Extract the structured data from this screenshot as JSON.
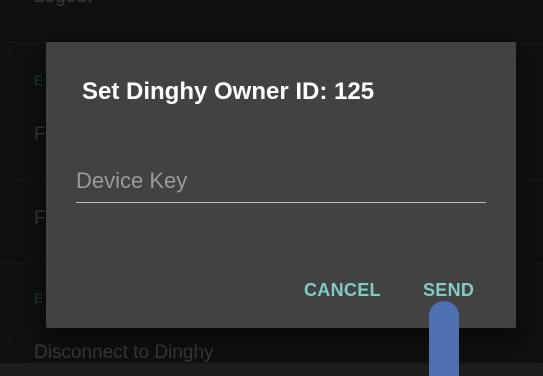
{
  "background": {
    "top_item": "Logout",
    "items": [
      "F",
      "F",
      "Disconnect to Dinghy"
    ],
    "section_letters": [
      "E",
      "E"
    ]
  },
  "dialog": {
    "title": "Set Dinghy Owner ID: 125",
    "input_placeholder": "Device Key",
    "input_value": "",
    "cancel_label": "CANCEL",
    "send_label": "SEND"
  },
  "colors": {
    "dialog_bg": "#424242",
    "accent": "#80cbc4",
    "pointer": "#4f6fb3"
  }
}
